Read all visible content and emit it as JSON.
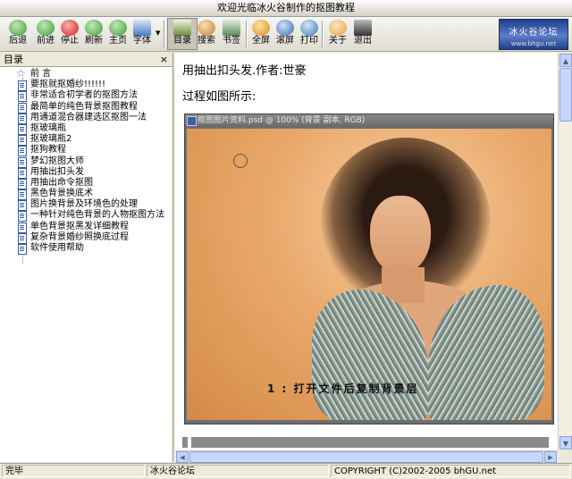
{
  "window": {
    "title": "欢迎光临冰火谷制作的抠图教程"
  },
  "toolbar": {
    "buttons": [
      {
        "label": "后退",
        "icon": "back-arrow-icon",
        "color": "#3f9a3c"
      },
      {
        "label": "前进",
        "icon": "forward-arrow-icon",
        "color": "#3f9a3c"
      },
      {
        "label": "停止",
        "icon": "stop-icon",
        "color": "#d42020"
      },
      {
        "label": "刷新",
        "icon": "refresh-icon",
        "color": "#3f9a3c"
      },
      {
        "label": "主页",
        "icon": "home-icon",
        "color": "#3f9a3c"
      },
      {
        "label": "字体",
        "icon": "font-icon",
        "color": "#4a7cc0"
      },
      {
        "label": "目录",
        "icon": "contents-icon",
        "color": "#6e8a3e"
      },
      {
        "label": "搜索",
        "icon": "search-icon",
        "color": "#c08030"
      },
      {
        "label": "书签",
        "icon": "bookmark-icon",
        "color": "#5a8a5a"
      },
      {
        "label": "全屏",
        "icon": "fullscreen-icon",
        "color": "#e08a10"
      },
      {
        "label": "滚屏",
        "icon": "scroll-icon",
        "color": "#3a6ab0"
      },
      {
        "label": "打印",
        "icon": "print-icon",
        "color": "#3a7ab8"
      },
      {
        "label": "关于",
        "icon": "about-icon",
        "color": "#e8a040"
      },
      {
        "label": "退出",
        "icon": "exit-icon",
        "color": "#333333"
      }
    ],
    "logo": {
      "text": "冰火谷论坛",
      "sub": "www.bhgu.net"
    }
  },
  "sidebar": {
    "header": "目录",
    "close_glyph": "×",
    "items": [
      {
        "label": "前  言",
        "kind": "star"
      },
      {
        "label": "要抠就抠婚纱!!!!!!",
        "kind": "doc"
      },
      {
        "label": "非常适合初学者的抠图方法",
        "kind": "doc"
      },
      {
        "label": "最简单的纯色背景抠图教程",
        "kind": "doc"
      },
      {
        "label": "用通道混合器建选区抠图一法",
        "kind": "doc"
      },
      {
        "label": "抠玻璃瓶",
        "kind": "doc"
      },
      {
        "label": "抠玻璃瓶2",
        "kind": "doc"
      },
      {
        "label": "抠狗教程",
        "kind": "doc"
      },
      {
        "label": "梦幻抠图大师",
        "kind": "doc"
      },
      {
        "label": "用抽出扣头发",
        "kind": "doc"
      },
      {
        "label": "用抽出命令抠图",
        "kind": "doc"
      },
      {
        "label": "黑色背景换底术",
        "kind": "doc"
      },
      {
        "label": "图片换背景及环境色的处理",
        "kind": "doc"
      },
      {
        "label": "一种针对纯色背景的人物抠图方法",
        "kind": "doc"
      },
      {
        "label": "单色背景抠黑发详细教程",
        "kind": "doc"
      },
      {
        "label": "复杂背景婚纱照换底过程",
        "kind": "doc"
      },
      {
        "label": "软件使用帮助",
        "kind": "doc"
      }
    ]
  },
  "article": {
    "title": "用抽出扣头发.作者:世豪",
    "subtitle": "过程如图所示:",
    "image_window_title": "抠图图片资料.psd @ 100% (背景 副本, RGB)",
    "caption": "1 : 打开文件后复制背景层"
  },
  "statusbar": {
    "status": "完毕",
    "forum": "冰火谷论坛",
    "copyright": "COPYRIGHT (C)2002-2005 bhGU.net"
  }
}
